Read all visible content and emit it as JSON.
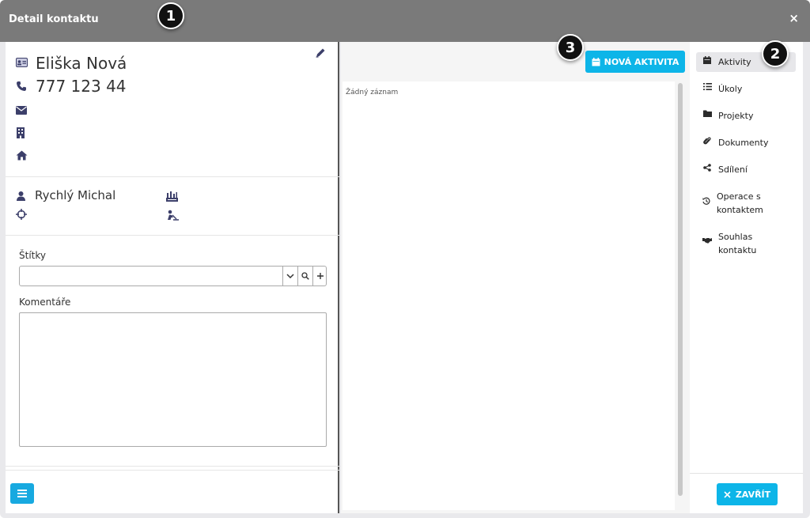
{
  "window": {
    "title": "Detail kontaktu",
    "close_symbol": "×"
  },
  "markers": [
    "1",
    "2",
    "3"
  ],
  "contact": {
    "name": "Eliška Nová",
    "phone": "777 123 44",
    "owner": "Rychlý Michal"
  },
  "icons": [
    "id-card-icon",
    "phone-icon",
    "envelope-icon",
    "building-icon",
    "home-icon",
    "user-icon",
    "factory-icon",
    "crosshair-icon",
    "worker-icon",
    "pencil-icon"
  ],
  "fields": {
    "tags_label": "Štítky",
    "tags_value": "",
    "comments_label": "Komentáře",
    "comments_value": ""
  },
  "middle": {
    "new_activity_label": "NOVÁ AKTIVITA",
    "empty_text": "Žádný záznam"
  },
  "nav": {
    "items": [
      {
        "label": "Aktivity",
        "icon": "calendar-icon",
        "active": true
      },
      {
        "label": "Úkoly",
        "icon": "list-icon"
      },
      {
        "label": "Projekty",
        "icon": "folder-icon"
      },
      {
        "label": "Dokumenty",
        "icon": "paperclip-icon"
      },
      {
        "label": "Sdílení",
        "icon": "share-icon"
      },
      {
        "label": "Operace s kontaktem",
        "icon": "history-icon"
      },
      {
        "label": "Souhlas kontaktu",
        "icon": "handshake-icon"
      }
    ],
    "close_label": "ZAVŘÍT"
  },
  "colors": {
    "accent": "#0db5e8",
    "titlebar": "#7a7a7a",
    "icon": "#3c3f6a"
  }
}
